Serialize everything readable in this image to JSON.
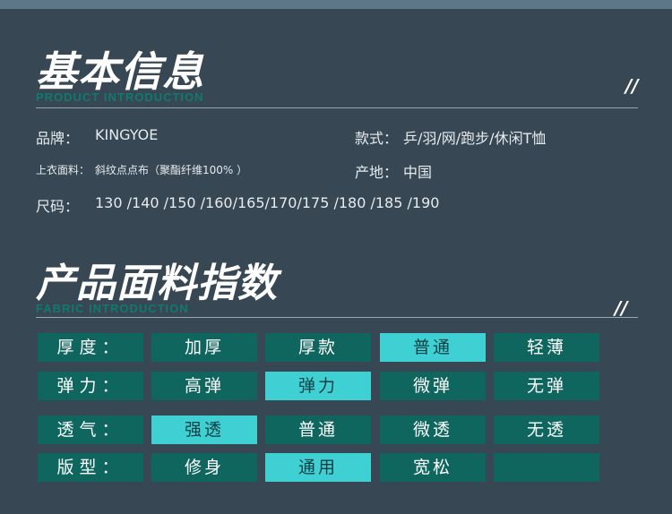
{
  "section1": {
    "title": "基本信息",
    "subtitle": "PRODUCT INTRODUCTION",
    "mark": "//"
  },
  "info": {
    "brand_label": "品牌：",
    "brand_value": "KINGYOE",
    "style_label": "款式：",
    "style_value": "乒/羽/网/跑步/休闲T恤",
    "fabric_label": "上衣面料：",
    "fabric_value": "斜纹点点布（聚酯纤维100%  ）",
    "origin_label": "产地：",
    "origin_value": "中国",
    "size_label": "尺码：",
    "size_value": "130 /140 /150 /160/165/170/175 /180 /185 /190"
  },
  "section2": {
    "title": "产品面料指数",
    "subtitle": "FABRIC INTRODUCTION",
    "mark": "//"
  },
  "colors": {
    "background": "#374754",
    "cell": "#0e665f",
    "cell_selected": "#3fd0d4",
    "subtitle": "#0f7a6e"
  },
  "fabric_index": [
    {
      "label": "厚度：",
      "options": [
        "加厚",
        "厚款",
        "普通",
        "轻薄"
      ],
      "selected": "普通"
    },
    {
      "label": "弹力：",
      "options": [
        "高弹",
        "弹力",
        "微弹",
        "无弹"
      ],
      "selected": "弹力"
    },
    {
      "label": "透气：",
      "options": [
        "强透",
        "普通",
        "微透",
        "无透"
      ],
      "selected": "强透"
    },
    {
      "label": "版型：",
      "options": [
        "修身",
        "通用",
        "宽松",
        ""
      ],
      "selected": "通用"
    }
  ]
}
